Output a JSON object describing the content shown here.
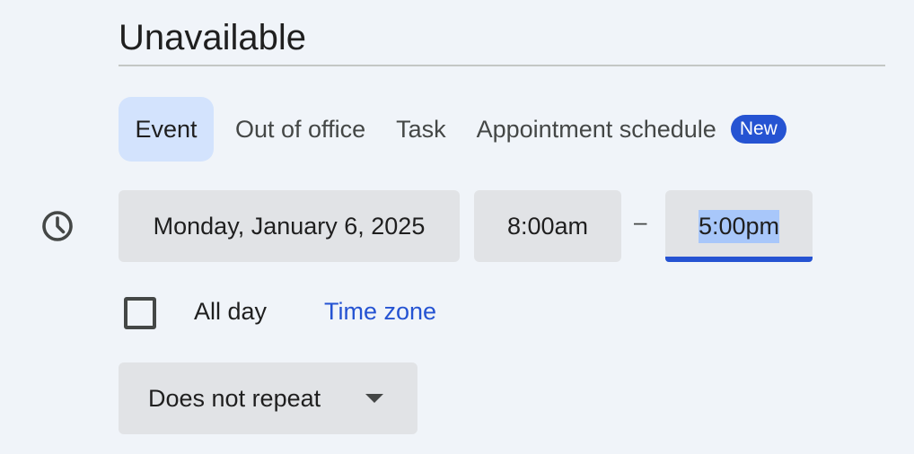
{
  "title": {
    "value": "Unavailable"
  },
  "tabs": [
    {
      "label": "Event",
      "active": true
    },
    {
      "label": "Out of office",
      "active": false
    },
    {
      "label": "Task",
      "active": false
    },
    {
      "label": "Appointment schedule",
      "active": false,
      "badge": "New"
    }
  ],
  "datetime": {
    "icon": "clock-icon",
    "date": "Monday, January 6, 2025",
    "start_time": "8:00am",
    "separator": "–",
    "end_time": "5:00pm"
  },
  "all_day": {
    "checked": false,
    "label": "All day"
  },
  "time_zone_link": "Time zone",
  "repeat": {
    "value": "Does not repeat",
    "icon": "dropdown-caret-icon"
  },
  "colors": {
    "background": "#f0f4f9",
    "active_tab": "#d3e3fd",
    "chip": "#e1e3e6",
    "accent": "#2553d2",
    "selection": "#a8c7fa"
  }
}
